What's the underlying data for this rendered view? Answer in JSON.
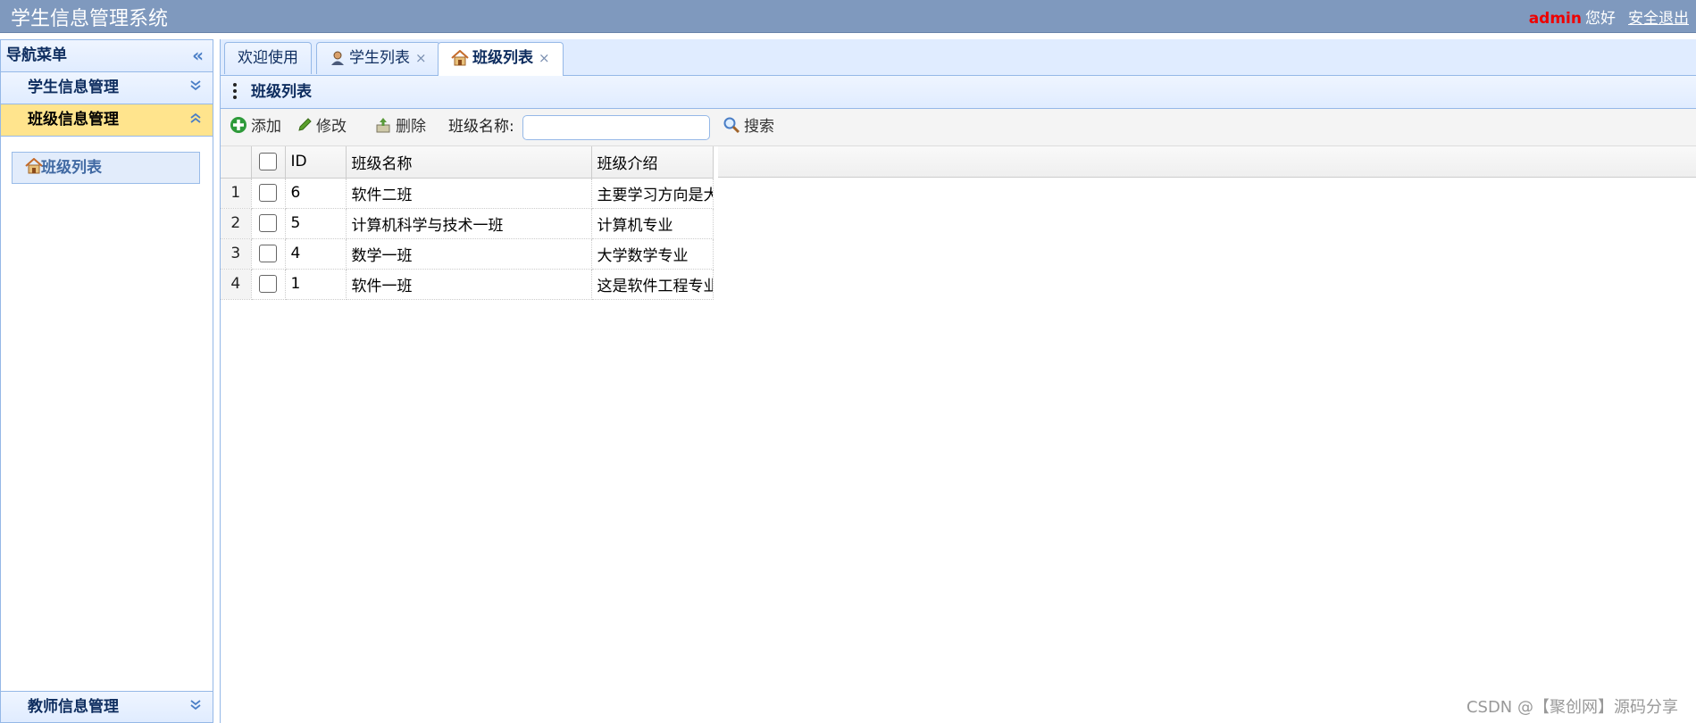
{
  "header": {
    "title": "学生信息管理系统",
    "username": "admin",
    "greeting": "您好",
    "logout": "安全退出"
  },
  "west": {
    "title": "导航菜单",
    "sections": [
      {
        "label": "学生信息管理",
        "expanded": false
      },
      {
        "label": "班级信息管理",
        "expanded": true,
        "selected": true,
        "items": [
          {
            "label": "班级列表",
            "icon": "home-icon"
          }
        ]
      },
      {
        "label": "教师信息管理",
        "expanded": false
      }
    ]
  },
  "tabs": [
    {
      "label": "欢迎使用",
      "closable": false,
      "active": false
    },
    {
      "label": "学生列表",
      "closable": true,
      "active": false,
      "icon": "user-icon"
    },
    {
      "label": "班级列表",
      "closable": true,
      "active": true,
      "icon": "home-icon"
    }
  ],
  "tab_close_glyph": "×",
  "panel": {
    "title": "班级列表"
  },
  "toolbar": {
    "add": "添加",
    "edit": "修改",
    "delete": "删除",
    "search_label": "班级名称:",
    "search_value": "",
    "search": "搜索"
  },
  "grid": {
    "columns": [
      "ID",
      "班级名称",
      "班级介绍"
    ],
    "rows": [
      {
        "num": "1",
        "id": "6",
        "name": "软件二班",
        "intro": "主要学习方向是大"
      },
      {
        "num": "2",
        "id": "5",
        "name": "计算机科学与技术一班",
        "intro": "计算机专业"
      },
      {
        "num": "3",
        "id": "4",
        "name": "数学一班",
        "intro": "大学数学专业"
      },
      {
        "num": "4",
        "id": "1",
        "name": "软件一班",
        "intro": "这是软件工程专业"
      }
    ]
  },
  "watermark": "CSDN @【聚创网】源码分享",
  "colors": {
    "header_bg": "#7f99be",
    "panel_border": "#95b8e7",
    "selected_accordion": "#ffe48d",
    "username": "#ee0000"
  }
}
